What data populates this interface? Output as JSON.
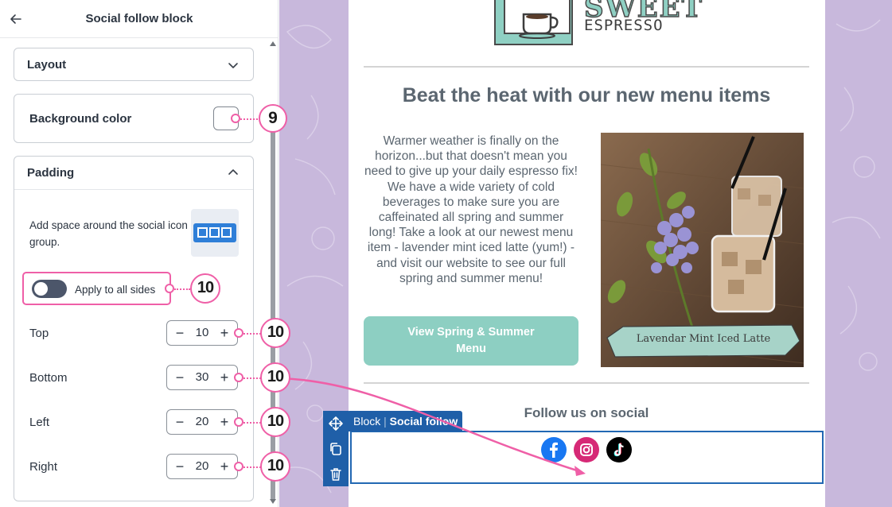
{
  "panel": {
    "title": "Social follow block",
    "layout_title": "Layout",
    "background_title": "Background color",
    "padding_title": "Padding",
    "padding_description": "Add space around the social icon group.",
    "apply_all_label": "Apply to all sides",
    "apply_all_on": false,
    "sides": [
      {
        "label": "Top",
        "value": "10"
      },
      {
        "label": "Bottom",
        "value": "30"
      },
      {
        "label": "Left",
        "value": "20"
      },
      {
        "label": "Right",
        "value": "20"
      }
    ],
    "minus_symbol": "−",
    "plus_symbol": "+"
  },
  "callouts": {
    "background": "9",
    "apply_all": "10",
    "top": "10",
    "bottom": "10",
    "left": "10",
    "right": "10"
  },
  "email": {
    "logo_top": "SWEET",
    "logo_sub": "ESPRESSO",
    "headline": "Beat the heat with our new menu items",
    "body": "Warmer weather is finally on the horizon...but that doesn't mean you need to give up your daily espresso fix! We have a wide variety of cold beverages to make sure you are caffeinated all spring and summer long! Take a look at our newest menu item - lavender mint iced latte (yum!) - and visit our website to see our full spring and summer menu!",
    "cta": "View Spring & Summer Menu",
    "photo_caption": "Lavendar Mint Iced Latte",
    "follow_title": "Follow us on social"
  },
  "block": {
    "tag_prefix": "Block",
    "tag_separator": "|",
    "tag_name": "Social follow"
  },
  "colors": {
    "accent_pink": "#ef5fa7",
    "selection_blue": "#1f5fa8",
    "teal": "#8dcfc2",
    "canvas_lavender": "#c8b8dc"
  }
}
